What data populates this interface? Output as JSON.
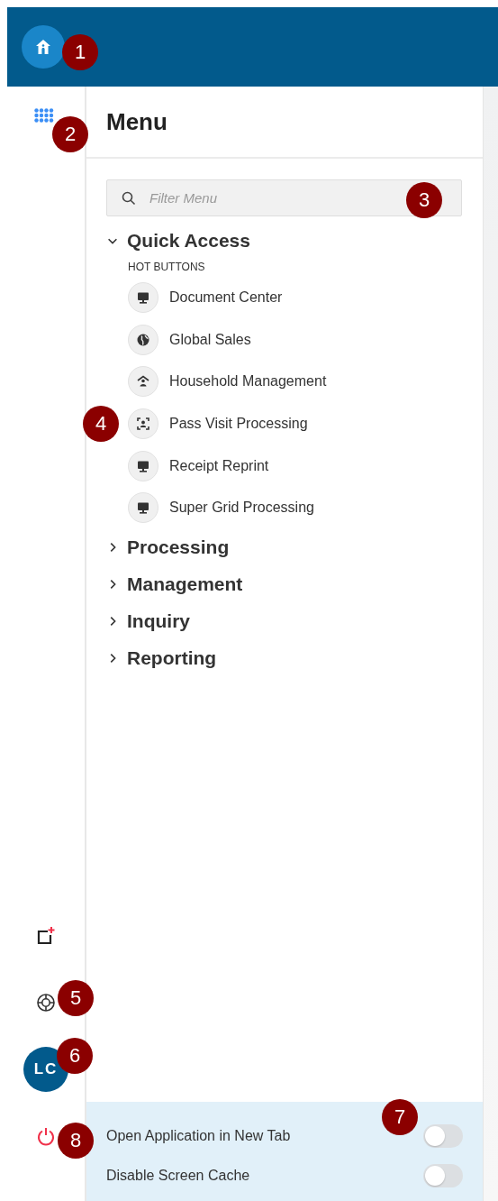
{
  "rail": {
    "avatar": "LC"
  },
  "menu": {
    "title": "Menu",
    "filter": {
      "placeholder": "Filter Menu"
    },
    "sections": [
      {
        "label": "Quick Access",
        "expanded": true,
        "group": "HOT BUTTONS",
        "items": [
          {
            "label": "Document Center",
            "kind": "monitor"
          },
          {
            "label": "Global Sales",
            "kind": "globe"
          },
          {
            "label": "Household Management",
            "kind": "house"
          },
          {
            "label": "Pass Visit Processing",
            "kind": "scan"
          },
          {
            "label": "Receipt Reprint",
            "kind": "monitor"
          },
          {
            "label": "Super Grid Processing",
            "kind": "monitor"
          }
        ]
      },
      {
        "label": "Processing",
        "expanded": false
      },
      {
        "label": "Management",
        "expanded": false
      },
      {
        "label": "Inquiry",
        "expanded": false
      },
      {
        "label": "Reporting",
        "expanded": false
      }
    ]
  },
  "settings": [
    {
      "label": "Open Application in New Tab",
      "on": false
    },
    {
      "label": "Disable Screen Cache",
      "on": false
    }
  ],
  "callouts": [
    "1",
    "2",
    "3",
    "4",
    "5",
    "6",
    "7",
    "8"
  ]
}
